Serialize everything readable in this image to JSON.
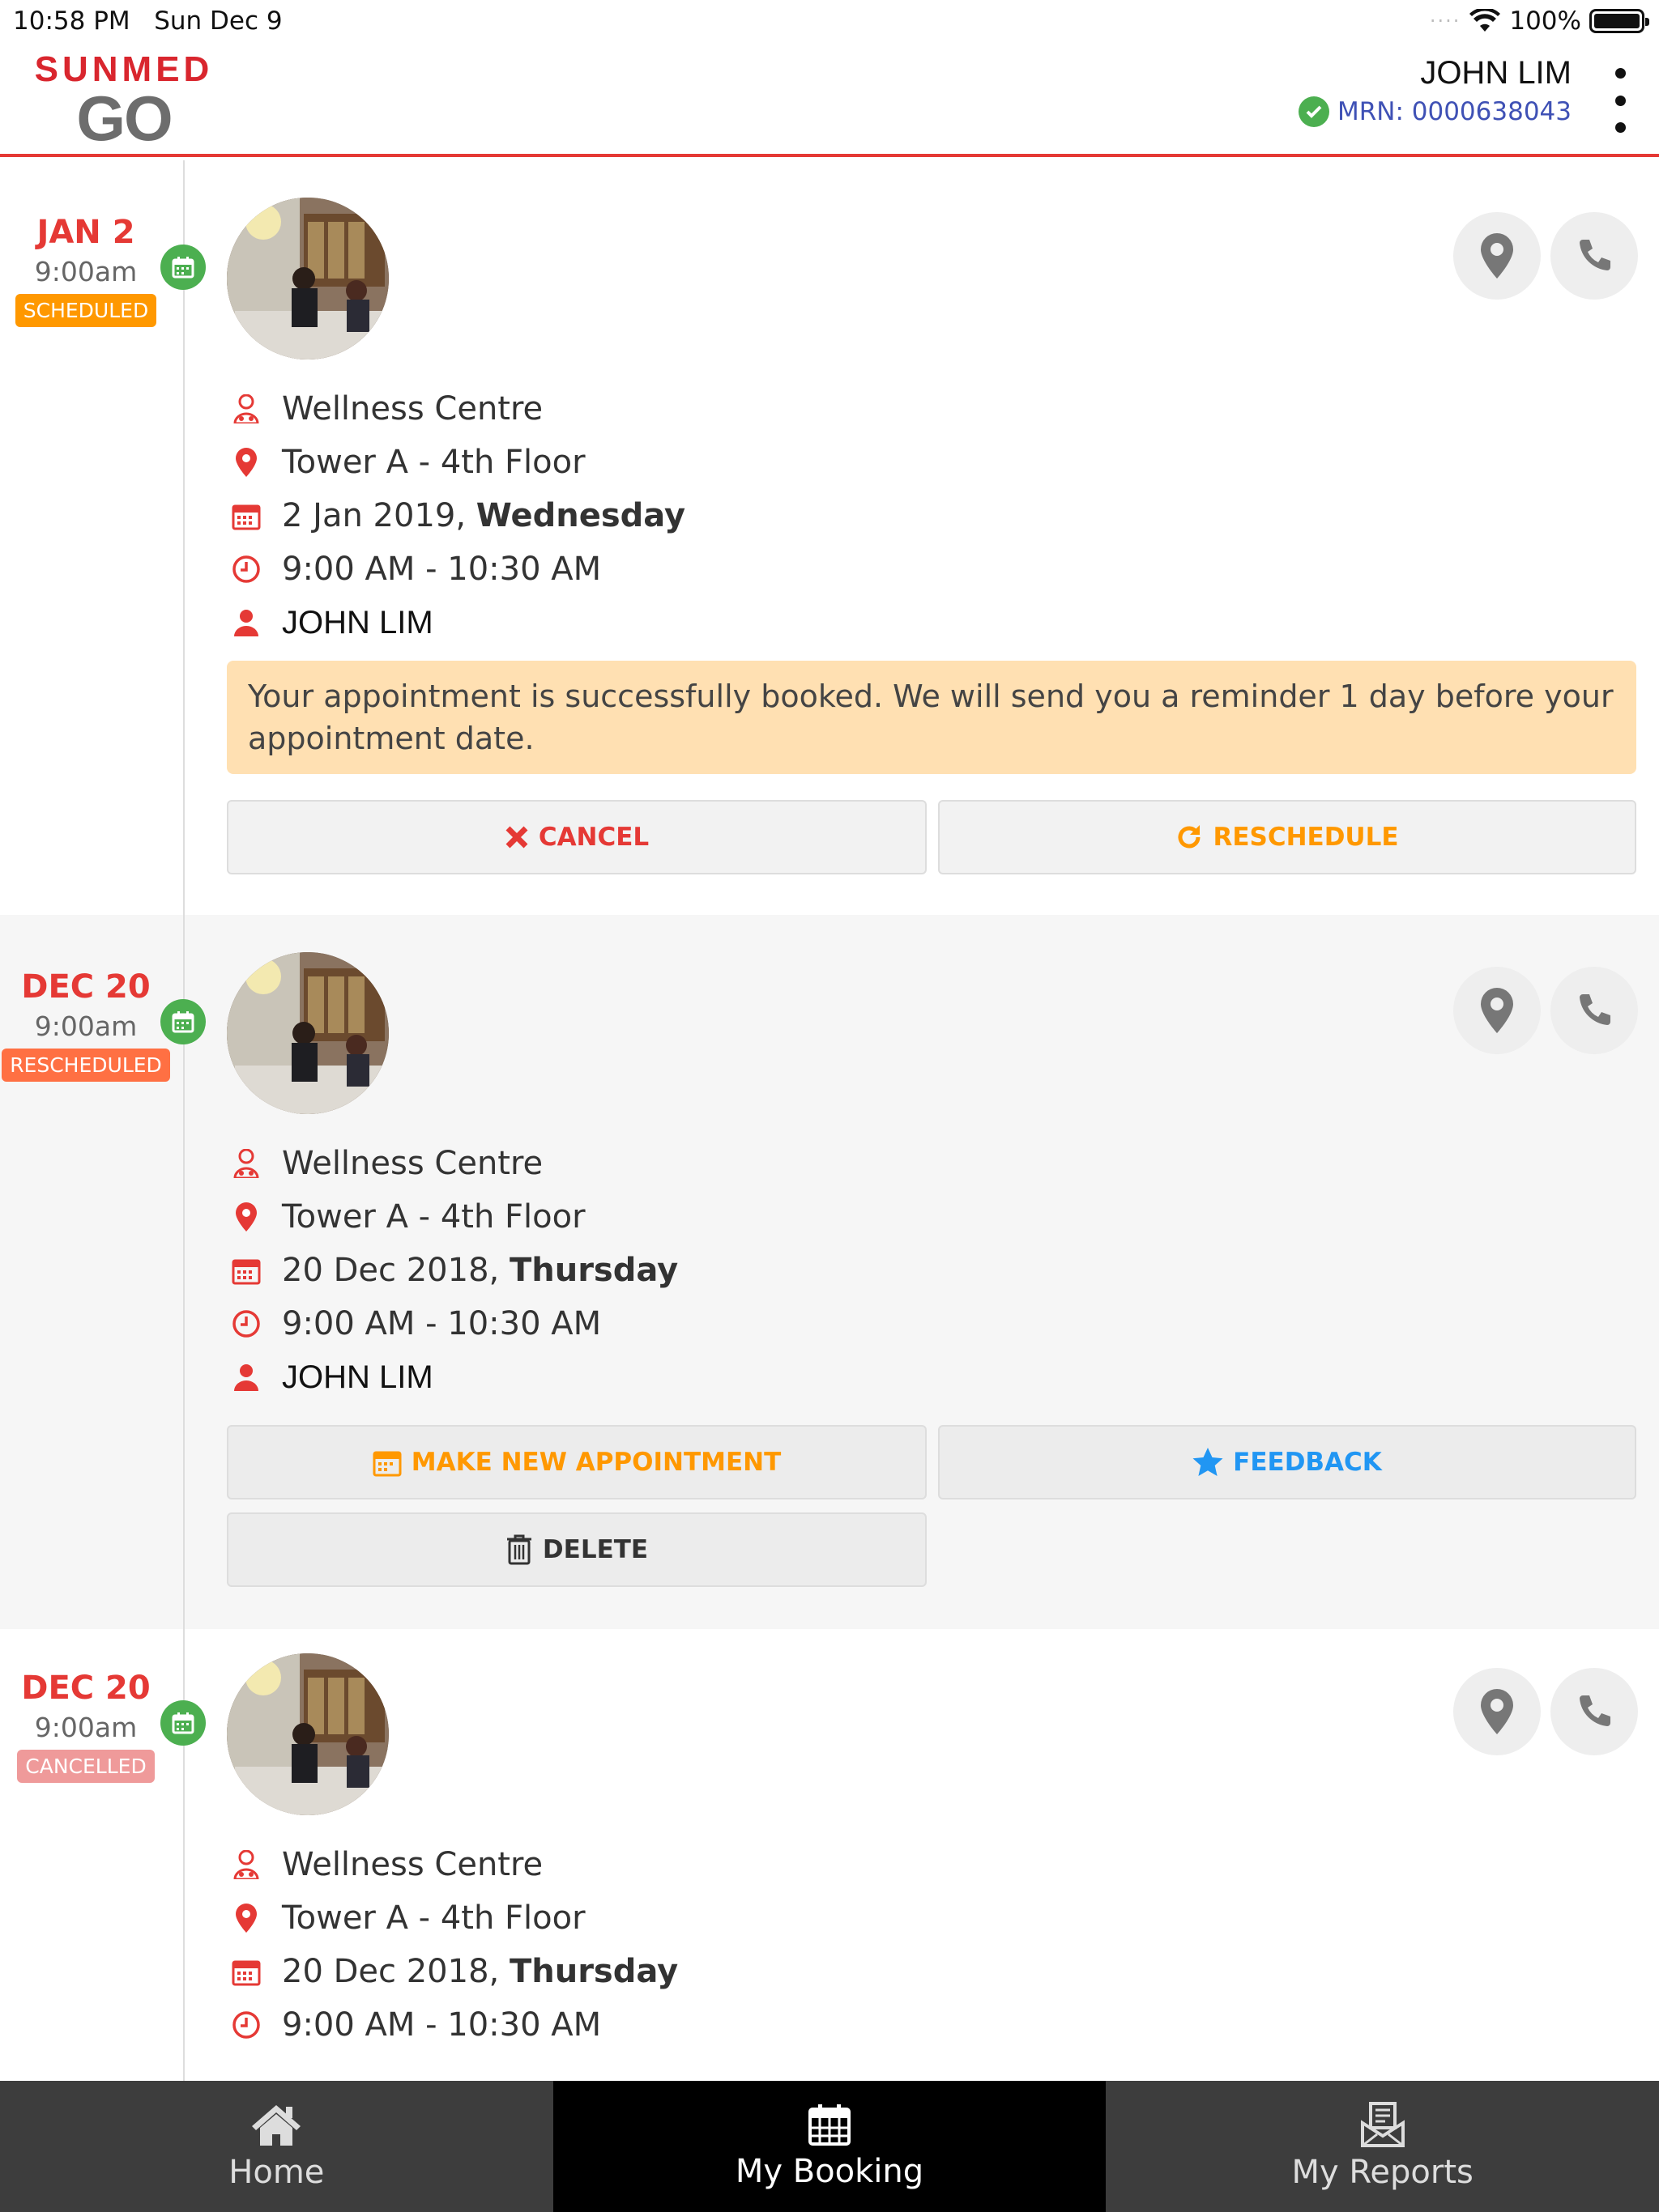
{
  "status_bar": {
    "time": "10:58 PM",
    "date": "Sun Dec 9",
    "battery": "100%"
  },
  "header": {
    "logo_top": "SUNMED",
    "logo_bottom": "GO",
    "user_name": "JOHN LIM",
    "mrn": "MRN: 0000638043"
  },
  "appointments": [
    {
      "date_short": "JAN 2",
      "time_short": "9:00am",
      "status": "SCHEDULED",
      "centre": "Wellness Centre",
      "location": "Tower A - 4th Floor",
      "date_long": "2 Jan 2019, ",
      "weekday": "Wednesday",
      "time_range": "9:00 AM - 10:30 AM",
      "patient": "JOHN LIM",
      "notice": "Your appointment is successfully booked. We will send you a reminder 1 day before your appointment date.",
      "buttons": {
        "cancel": "CANCEL",
        "reschedule": "RESCHEDULE"
      }
    },
    {
      "date_short": "DEC 20",
      "time_short": "9:00am",
      "status": "RESCHEDULED",
      "centre": "Wellness Centre",
      "location": "Tower A - 4th Floor",
      "date_long": "20 Dec 2018, ",
      "weekday": "Thursday",
      "time_range": "9:00 AM - 10:30 AM",
      "patient": "JOHN LIM",
      "buttons": {
        "new": "MAKE NEW APPOINTMENT",
        "feedback": "FEEDBACK",
        "delete": "DELETE"
      }
    },
    {
      "date_short": "DEC 20",
      "time_short": "9:00am",
      "status": "CANCELLED",
      "centre": "Wellness Centre",
      "location": "Tower A - 4th Floor",
      "date_long": "20 Dec 2018, ",
      "weekday": "Thursday",
      "time_range": "9:00 AM - 10:30 AM"
    }
  ],
  "tabs": [
    {
      "label": "Home",
      "icon": "home-icon"
    },
    {
      "label": "My Booking",
      "icon": "calendar-icon"
    },
    {
      "label": "My Reports",
      "icon": "reports-icon"
    }
  ],
  "colors": {
    "brand_red": "#e53935",
    "scheduled": "#ff9800",
    "rescheduled": "#ff7043",
    "cancelled": "#ef9a9a",
    "feedback_blue": "#2196f3",
    "notice_bg": "#ffe0b2",
    "tabbar": "#3d3d3d"
  }
}
